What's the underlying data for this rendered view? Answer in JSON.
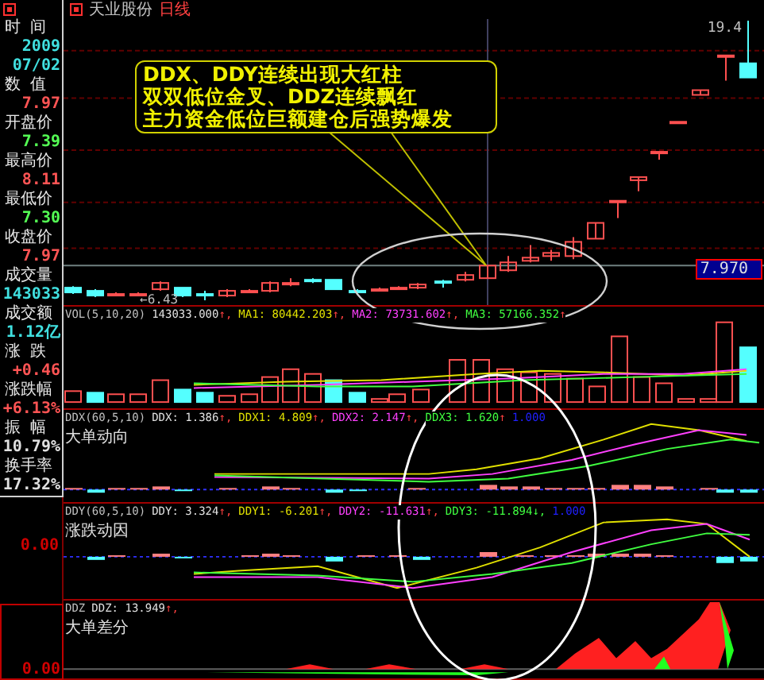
{
  "title": {
    "stock": "天业股份",
    "period": "日线"
  },
  "top_right": {
    "reading": "19.4"
  },
  "info": [
    {
      "label": "时 间",
      "values": [
        {
          "text": "2009",
          "color": "#40e0e0"
        },
        {
          "text": "07/02",
          "color": "#40e0e0"
        }
      ]
    },
    {
      "label": "数 值",
      "values": [
        {
          "text": "7.97",
          "color": "#ff5454"
        }
      ]
    },
    {
      "label": "开盘价",
      "values": [
        {
          "text": "7.39",
          "color": "#54ff54"
        }
      ]
    },
    {
      "label": "最高价",
      "values": [
        {
          "text": "8.11",
          "color": "#ff5454"
        }
      ]
    },
    {
      "label": "最低价",
      "values": [
        {
          "text": "7.30",
          "color": "#54ff54"
        }
      ]
    },
    {
      "label": "收盘价",
      "values": [
        {
          "text": "7.97",
          "color": "#ff5454"
        }
      ]
    },
    {
      "label": "成交量",
      "values": [
        {
          "text": "143033",
          "color": "#40e0e0"
        }
      ]
    },
    {
      "label": "成交额",
      "values": [
        {
          "text": "1.12亿",
          "color": "#40e0e0"
        }
      ]
    },
    {
      "label": "涨 跌",
      "values": [
        {
          "text": "+0.46",
          "color": "#ff5454"
        }
      ]
    },
    {
      "label": "涨跌幅",
      "values": [
        {
          "text": "+6.13%",
          "color": "#ff5454"
        }
      ]
    },
    {
      "label": "振 幅",
      "values": [
        {
          "text": "10.79%",
          "color": "#e0e0e0"
        }
      ]
    },
    {
      "label": "换手率",
      "values": [
        {
          "text": "17.32%",
          "color": "#e0e0e0"
        }
      ]
    }
  ],
  "price_chart": {
    "callout": [
      "DDX、DDY连续出现大红柱",
      "双双低位金叉、DDZ连续飘红",
      "主力资金低位巨额建仓后强势爆发"
    ],
    "last_price": "7.970",
    "low_marker": "←6.43"
  },
  "panels": [
    {
      "kind": "vol",
      "legend": [
        {
          "text": "VOL(5,10,20)",
          "color": "#c0c0c0"
        },
        {
          "text": "143033.000",
          "color": "#e0e0e0",
          "arrow": "↑,"
        },
        {
          "text": "MA1: 80442.203",
          "color": "#e0e000",
          "arrow": "↑,"
        },
        {
          "text": "MA2: 73731.602",
          "color": "#ff40ff",
          "arrow": "↑,"
        },
        {
          "text": "MA3: 57166.352",
          "color": "#40ff40",
          "arrow": "↑"
        }
      ]
    },
    {
      "kind": "ddx",
      "caption": "大单动向",
      "legend": [
        {
          "text": "DDX(60,5,10)",
          "color": "#c0c0c0"
        },
        {
          "text": "DDX: 1.386",
          "color": "#e0e0e0",
          "arrow": "↑,"
        },
        {
          "text": "DDX1: 4.809",
          "color": "#e0e000",
          "arrow": "↑,"
        },
        {
          "text": "DDX2: 2.147",
          "color": "#ff40ff",
          "arrow": "↑,"
        },
        {
          "text": "DDX3: 1.620",
          "color": "#40ff40",
          "arrow": "↑"
        },
        {
          "text": "1.000",
          "color": "#2020ff"
        }
      ]
    },
    {
      "kind": "ddy",
      "caption": "涨跌动因",
      "zero_label": "0.00",
      "legend": [
        {
          "text": "DDY(60,5,10)",
          "color": "#c0c0c0"
        },
        {
          "text": "DDY: 3.324",
          "color": "#e0e0e0",
          "arrow": "↑,"
        },
        {
          "text": "DDY1: -6.201",
          "color": "#e0e000",
          "arrow": "↑,"
        },
        {
          "text": "DDY2: -11.631",
          "color": "#ff40ff",
          "arrow": "↑,"
        },
        {
          "text": "DDY3: -11.894",
          "color": "#40ff40",
          "arrow": "↓,"
        },
        {
          "text": "1.000",
          "color": "#2020ff"
        }
      ]
    },
    {
      "kind": "ddz",
      "caption": "大单差分",
      "zero_label": "0.00",
      "legend": [
        {
          "text": "DDZ",
          "color": "#c0c0c0"
        },
        {
          "text": "DDZ: 13.949",
          "color": "#e0e0e0",
          "arrow": "↑,"
        }
      ]
    }
  ]
}
